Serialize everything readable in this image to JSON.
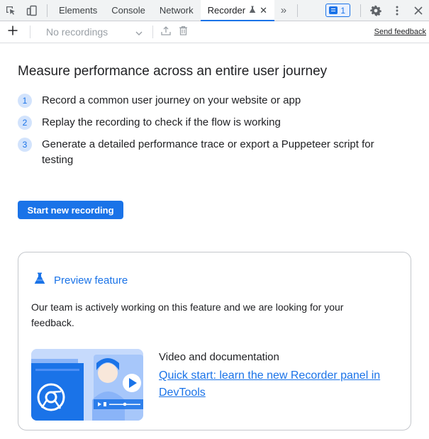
{
  "tabbar": {
    "tabs": [
      {
        "label": "Elements"
      },
      {
        "label": "Console"
      },
      {
        "label": "Network"
      },
      {
        "label": "Recorder"
      }
    ],
    "issues_count": "1",
    "icons": [
      "inspect-icon",
      "device-toggle-icon",
      "flask-icon",
      "close-icon",
      "more-tabs-icon",
      "issues-icon",
      "gear-icon",
      "kebab-menu-icon",
      "close-devtools-icon"
    ]
  },
  "toolbar": {
    "recording_select_placeholder": "No recordings",
    "send_feedback": "Send feedback",
    "icons": [
      "plus-icon",
      "chevron-down-icon",
      "export-icon",
      "trash-icon"
    ]
  },
  "main": {
    "heading": "Measure performance across an entire user journey",
    "steps": [
      {
        "num": "1",
        "text": "Record a common user journey on your website or app"
      },
      {
        "num": "2",
        "text": "Replay the recording to check if the flow is working"
      },
      {
        "num": "3",
        "text": "Generate a detailed performance trace or export a Puppeteer script for testing"
      }
    ],
    "start_button": "Start new recording"
  },
  "card": {
    "preview_label": "Preview feature",
    "description": "Our team is actively working on this feature and we are looking for your feedback.",
    "video_title": "Video and documentation",
    "video_link": "Quick start: learn the new Recorder panel in DevTools"
  },
  "colors": {
    "accent": "#1a73e8",
    "step_bubble": "#d2e3fc",
    "tabbar_bg": "#f1f3f4",
    "card_border": "#c4c7cc"
  }
}
